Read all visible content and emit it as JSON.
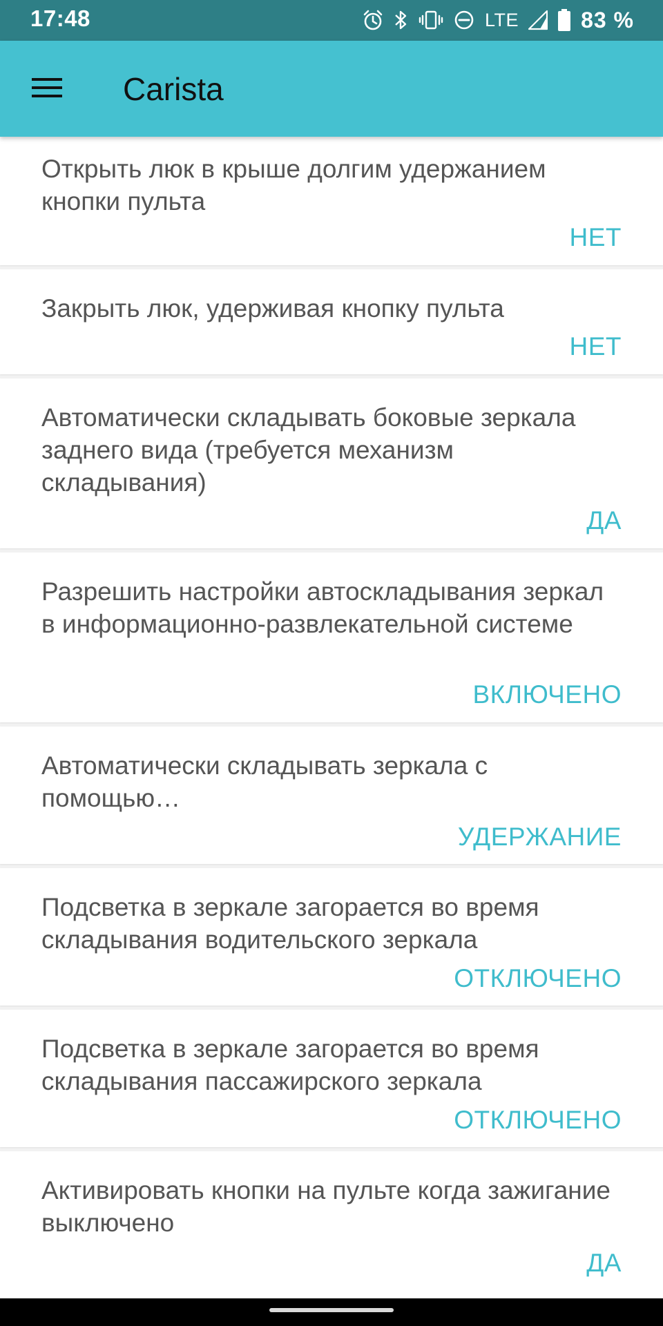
{
  "status_bar": {
    "time": "17:48",
    "network": "LTE",
    "battery": "83 %",
    "icons": [
      "alarm-icon",
      "bluetooth-icon",
      "vibrate-icon",
      "do-not-disturb-icon",
      "signal-icon",
      "battery-icon"
    ]
  },
  "app_bar": {
    "title": "Carista",
    "menu_icon": "hamburger-menu-icon"
  },
  "settings": [
    {
      "label": "Открыть люк в крыше долгим удержанием кнопки пульта",
      "value": "НЕТ"
    },
    {
      "label": "Закрыть люк, удерживая кнопку пульта",
      "value": "НЕТ"
    },
    {
      "label": "Автоматически складывать боковые зеркала заднего вида (требуется механизм складывания)",
      "value": "ДА"
    },
    {
      "label": "Разрешить настройки автоскладывания зеркал в информационно-развлекательной системе",
      "value": "ВКЛЮЧЕНО"
    },
    {
      "label": "Автоматически складывать зеркала с помощью…",
      "value": "УДЕРЖАНИЕ"
    },
    {
      "label": "Подсветка в зеркале загорается во время складывания водительского зеркала",
      "value": "ОТКЛЮЧЕНО"
    },
    {
      "label": "Подсветка в зеркале загорается во время складывания пассажирского зеркала",
      "value": "ОТКЛЮЧЕНО"
    },
    {
      "label": "Активировать кнопки на пульте когда зажигание выключено",
      "value": "ДА"
    }
  ],
  "colors": {
    "status_bar": "#2e7f86",
    "app_bar": "#45c1d0",
    "accent": "#3fbccc",
    "label_text": "#555555"
  }
}
